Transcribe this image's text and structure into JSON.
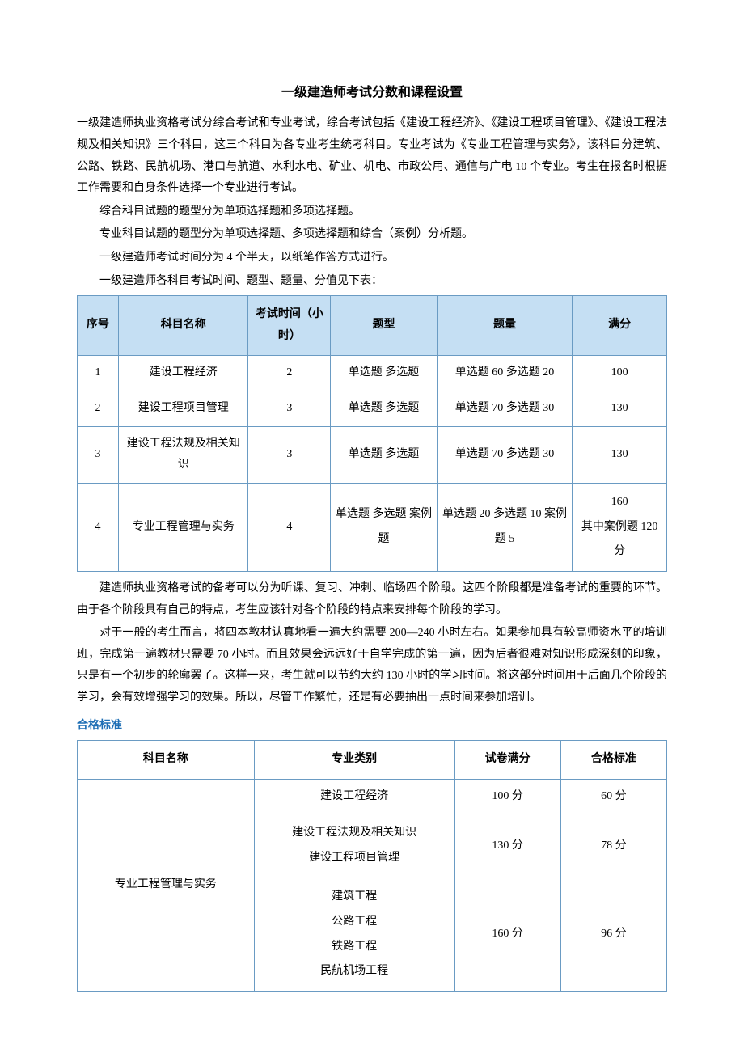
{
  "title": "一级建造师考试分数和课程设置",
  "intro": "一级建造师执业资格考试分综合考试和专业考试，综合考试包括《建设工程经济》、《建设工程项目管理》、《建设工程法规及相关知识》三个科目，这三个科目为各专业考生统考科目。专业考试为《专业工程管理与实务》，该科目分建筑、公路、铁路、民航机场、港口与航道、水利水电、矿业、机电、市政公用、通信与广电 10 个专业。考生在报名时根据工作需要和自身条件选择一个专业进行考试。",
  "bullets": [
    "综合科目试题的题型分为单项选择题和多项选择题。",
    "专业科目试题的题型分为单项选择题、多项选择题和综合（案例）分析题。",
    "一级建造师考试时间分为 4 个半天，以纸笔作答方式进行。",
    "一级建造师各科目考试时间、题型、题量、分值见下表："
  ],
  "table1": {
    "headers": [
      "序号",
      "科目名称",
      "考试时间（小时）",
      "题型",
      "题量",
      "满分"
    ],
    "rows": [
      {
        "idx": "1",
        "name": "建设工程经济",
        "hours": "2",
        "type": "单选题 多选题",
        "qty": "单选题 60 多选题 20",
        "full": "100"
      },
      {
        "idx": "2",
        "name": "建设工程项目管理",
        "hours": "3",
        "type": "单选题 多选题",
        "qty": "单选题 70 多选题 30",
        "full": "130"
      },
      {
        "idx": "3",
        "name": "建设工程法规及相关知识",
        "hours": "3",
        "type": "单选题 多选题",
        "qty": "单选题 70 多选题 30",
        "full": "130"
      },
      {
        "idx": "4",
        "name": "专业工程管理与实务",
        "hours": "4",
        "type": "单选题 多选题 案例题",
        "qty": "单选题 20 多选题 10 案例题 5",
        "full": "160\n其中案例题 120分"
      }
    ]
  },
  "post1": "建造师执业资格考试的备考可以分为听课、复习、冲刺、临场四个阶段。这四个阶段都是准备考试的重要的环节。由于各个阶段具有自己的特点，考生应该针对各个阶段的特点来安排每个阶段的学习。",
  "post2": "对于一般的考生而言，将四本教材认真地看一遍大约需要 200—240 小时左右。如果参加具有较高师资水平的培训班，完成第一遍教材只需要 70 小时。而且效果会远远好于自学完成的第一遍，因为后者很难对知识形成深刻的印象，只是有一个初步的轮廓罢了。这样一来，考生就可以节约大约 130 小时的学习时间。将这部分时间用于后面几个阶段的学习，会有效增强学习的效果。所以，尽管工作繁忙，还是有必要抽出一点时间来参加培训。",
  "section2_heading": "合格标准",
  "table2": {
    "headers": [
      "科目名称",
      "专业类别",
      "试卷满分",
      "合格标准"
    ],
    "subject": "专业工程管理与实务",
    "rows": [
      {
        "cat": "建设工程经济",
        "full": "100 分",
        "pass": "60 分"
      },
      {
        "cat": "建设工程法规及相关知识\n建设工程项目管理",
        "full": "130 分",
        "pass": "78 分"
      },
      {
        "cat": "建筑工程\n公路工程\n铁路工程\n民航机场工程",
        "full": "160 分",
        "pass": "96 分"
      }
    ]
  }
}
